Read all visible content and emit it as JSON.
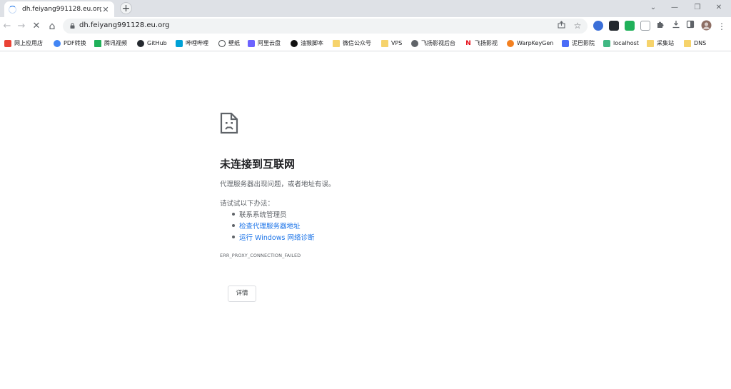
{
  "browser": {
    "tab": {
      "title": "dh.feiyang991128.eu.org",
      "close": "✕"
    },
    "new_tab": "+",
    "window_controls": {
      "minimize": "—",
      "restore": "❐",
      "close": "✕",
      "tab_search": "⌄"
    },
    "nav": {
      "back": "←",
      "forward": "→",
      "reload": "✕",
      "home": "⌂"
    },
    "address_bar": {
      "url": "dh.feiyang991128.eu.org"
    }
  },
  "bookmarks": [
    {
      "label": "网上应用店",
      "icon": "chrome-web-store-icon",
      "color": "#ea4335"
    },
    {
      "label": "PDF转换",
      "icon": "pdf-convert-icon",
      "color": "#4285f4"
    },
    {
      "label": "腾讯视频",
      "icon": "tencent-video-icon",
      "color": "#20b15a"
    },
    {
      "label": "GitHub",
      "icon": "github-icon",
      "color": "#24292f"
    },
    {
      "label": "哔哩哔哩",
      "icon": "bilibili-icon",
      "color": "#00a1d6"
    },
    {
      "label": "壁纸",
      "icon": "wallpaper-icon",
      "color": "#3c4043"
    },
    {
      "label": "阿里云盘",
      "icon": "aliyun-drive-icon",
      "color": "#6c63ff"
    },
    {
      "label": "油猴脚本",
      "icon": "tampermonkey-icon",
      "color": "#111111"
    },
    {
      "label": "微信公众号",
      "icon": "folder-icon",
      "color": "#f6d36b"
    },
    {
      "label": "VPS",
      "icon": "folder-icon",
      "color": "#f6d36b"
    },
    {
      "label": "飞扬影视后台",
      "icon": "globe-icon",
      "color": "#5f6368"
    },
    {
      "label": "飞扬影视",
      "icon": "netflix-icon",
      "color": "#e50914"
    },
    {
      "label": "WarpKeyGen",
      "icon": "warp-icon",
      "color": "#f38020"
    },
    {
      "label": "泥巴影院",
      "icon": "play-icon",
      "color": "#4a6cf7"
    },
    {
      "label": "localhost",
      "icon": "vue-icon",
      "color": "#35495e"
    },
    {
      "label": "采集站",
      "icon": "folder-icon",
      "color": "#f6d36b"
    },
    {
      "label": "DNS",
      "icon": "folder-icon",
      "color": "#f6d36b"
    }
  ],
  "error_page": {
    "title": "未连接到互联网",
    "summary": "代理服务器出现问题，或者地址有误。",
    "try_heading": "请试试以下办法：",
    "suggestions": [
      {
        "text": "联系系统管理员",
        "link": false
      },
      {
        "text": "检查代理服务器地址",
        "link": true
      },
      {
        "text": "运行 Windows 网络诊断",
        "link": true
      }
    ],
    "error_code": "ERR_PROXY_CONNECTION_FAILED",
    "details_button": "详情"
  },
  "colors": {
    "accent": "#1a73e8",
    "tabstrip": "#dee1e6",
    "omnibox": "#f1f3f4",
    "secondary_text": "#5f6368"
  }
}
